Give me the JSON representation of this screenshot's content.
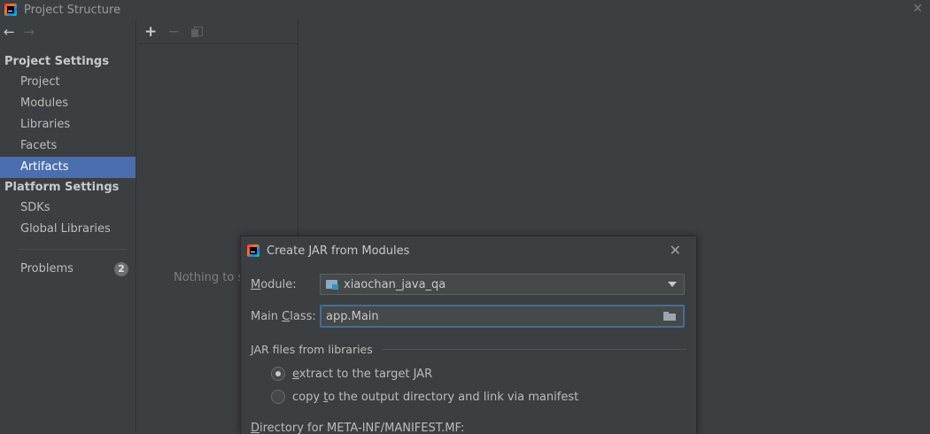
{
  "window": {
    "title": "Project Structure",
    "close_glyph": "✕"
  },
  "sidebar": {
    "back_glyph": "←",
    "forward_glyph": "→",
    "sections": [
      {
        "header": "Project Settings",
        "items": [
          "Project",
          "Modules",
          "Libraries",
          "Facets",
          "Artifacts"
        ]
      },
      {
        "header": "Platform Settings",
        "items": [
          "SDKs",
          "Global Libraries"
        ]
      }
    ],
    "selected_item": "Artifacts",
    "problems": {
      "label": "Problems",
      "count": "2"
    }
  },
  "middle_panel": {
    "add_glyph": "+",
    "remove_glyph": "−",
    "empty_text": "Nothing to s"
  },
  "dialog": {
    "title": "Create JAR from Modules",
    "close_glyph": "✕",
    "module": {
      "label_before": "",
      "label_mnemonic": "M",
      "label_after": "odule:",
      "value": "xiaochan_java_qa"
    },
    "main_class": {
      "label_before": "Main ",
      "label_mnemonic": "C",
      "label_after": "lass:",
      "value": "app.Main"
    },
    "jar_group_title": "JAR files from libraries",
    "options": [
      {
        "before": "",
        "mnemonic": "e",
        "after": "xtract to the target JAR",
        "checked": true
      },
      {
        "before": "copy ",
        "mnemonic": "t",
        "after": "o the output directory and link via manifest",
        "checked": false
      }
    ],
    "manifest_dir": {
      "label_before": "",
      "label_mnemonic": "D",
      "label_after": "irectory for META-INF/MANIFEST.MF:"
    }
  },
  "colors": {
    "background": "#3c3f41",
    "selection": "#4b6eaf",
    "focus_border": "#466d94"
  },
  "icons": [
    "intellij-app-icon",
    "arrow-left-icon",
    "arrow-right-icon",
    "add-icon",
    "remove-icon",
    "copy-icon",
    "module-icon",
    "chevron-down-icon",
    "folder-icon",
    "close-icon"
  ]
}
